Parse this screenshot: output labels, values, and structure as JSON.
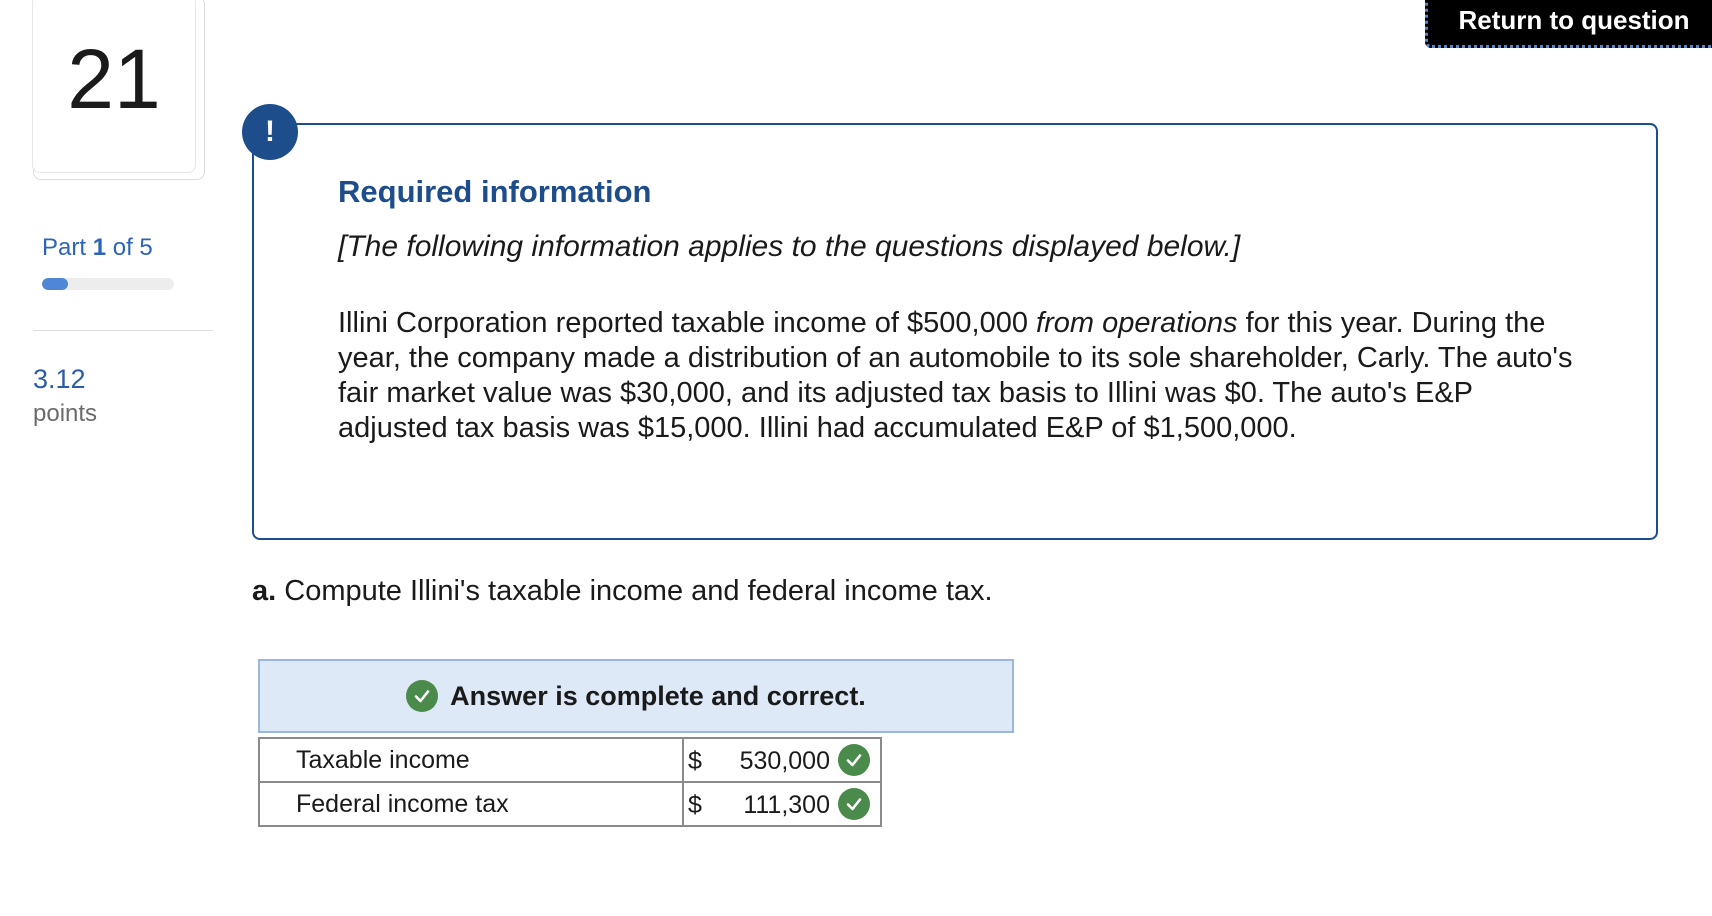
{
  "question_number": "21",
  "part": {
    "prefix": "Part",
    "current": "1",
    "of_text": "of 5",
    "progress_fraction": 0.2
  },
  "points": {
    "value": "3.12",
    "label": "points"
  },
  "return_button": {
    "label": "Return to question"
  },
  "info": {
    "icon": "!",
    "title": "Required information",
    "subtitle": "[The following information applies to the questions displayed below.]",
    "body_part1": "Illini Corporation reported taxable income of $500,000 ",
    "body_italic": "from operations",
    "body_part2": " for this year. During the year, the company made a distribution of an automobile to its sole shareholder, Carly. The auto's fair market value was $30,000, and its adjusted tax basis to Illini was $0. The auto's E&P adjusted tax basis was $15,000. Illini had accumulated E&P of $1,500,000."
  },
  "question": {
    "label": "a.",
    "text": " Compute Illini's taxable income and federal income tax."
  },
  "answer": {
    "status": "Answer is complete and correct.",
    "rows": [
      {
        "label": "Taxable income",
        "currency": "$",
        "amount": "530,000"
      },
      {
        "label": "Federal income tax",
        "currency": "$",
        "amount": "111,300"
      }
    ]
  },
  "colors": {
    "accent": "#1e4d8c",
    "link": "#2d63b8",
    "correct": "#4a8a4a",
    "banner": "#dde9f7"
  }
}
